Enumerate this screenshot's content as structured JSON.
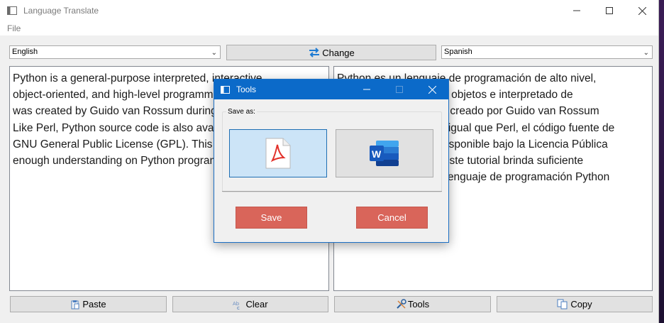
{
  "window": {
    "title": "Language Translate",
    "menu": [
      "File"
    ],
    "controls": {
      "minimize": "—",
      "maximize": "☐",
      "close": "✕"
    }
  },
  "toolbar": {
    "source_language": "English",
    "change_label": "Change",
    "target_language": "Spanish"
  },
  "source_text": [
    "Python is a general-purpose interpreted, interactive,",
    "object-oriented, and high-level programming language. It",
    "was created by Guido van Rossum during 1985- 1990.",
    "Like Perl, Python source code is also available under the",
    "GNU General Public License (GPL). This tutorial gives",
    "enough understanding on Python programming language."
  ],
  "target_text": [
    "Python es un lenguaje de programación de alto nivel,",
    "interactivo, orientado a objetos e interpretado de",
    "propósito general. Fue creado por Guido van Rossum",
    "durante 1985-1990. Al igual que Perl, el código fuente de",
    "Python también está disponible bajo la Licencia Pública",
    "General GNU (GPL). Este tutorial brinda suficiente",
    "comprensión sobre el lenguaje de programación Python"
  ],
  "bottom_buttons": {
    "paste": "Paste",
    "clear": "Clear",
    "tools": "Tools",
    "copy": "Copy"
  },
  "dialog": {
    "title": "Tools",
    "group_label": "Save as:",
    "formats": [
      "pdf-icon",
      "word-icon"
    ],
    "save_label": "Save",
    "cancel_label": "Cancel"
  },
  "colors": {
    "dialog_titlebar": "#0b6ac9",
    "action_button": "#d9655a",
    "selected_format": "#cce4f7"
  }
}
